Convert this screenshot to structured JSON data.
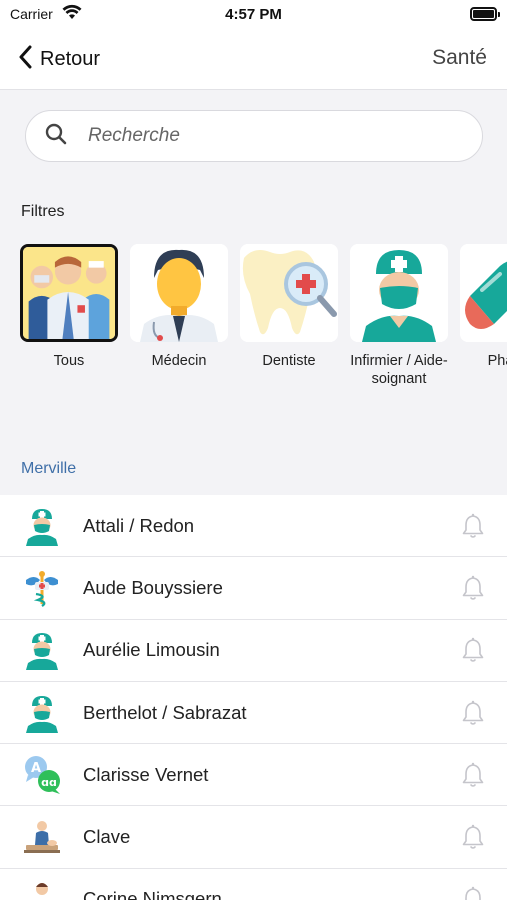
{
  "status_bar": {
    "carrier": "Carrier",
    "time": "4:57 PM"
  },
  "nav": {
    "back_label": "Retour",
    "title": "Santé"
  },
  "search": {
    "placeholder": "Recherche",
    "value": ""
  },
  "filters": {
    "label": "Filtres",
    "items": [
      {
        "label": "Tous",
        "icon": "medical-team-icon",
        "selected": true
      },
      {
        "label": "Médecin",
        "icon": "doctor-icon",
        "selected": false
      },
      {
        "label": "Dentiste",
        "icon": "tooth-icon",
        "selected": false
      },
      {
        "label": "Infirmier / Aide-soignant",
        "icon": "nurse-icon",
        "selected": false
      },
      {
        "label": "Pharm",
        "icon": "pill-icon",
        "selected": false
      }
    ]
  },
  "section": {
    "title": "Merville"
  },
  "list": [
    {
      "name": "Attali / Redon",
      "icon": "nurse-icon"
    },
    {
      "name": "Aude Bouyssiere",
      "icon": "caduceus-icon"
    },
    {
      "name": "Aurélie Limousin",
      "icon": "nurse-icon"
    },
    {
      "name": "Berthelot / Sabrazat",
      "icon": "nurse-icon"
    },
    {
      "name": "Clarisse Vernet",
      "icon": "speech-bubbles-icon"
    },
    {
      "name": "Clave",
      "icon": "physiotherapist-icon"
    },
    {
      "name": "Corine Nimsgern",
      "icon": "person-icon"
    }
  ],
  "colors": {
    "accent": "#3f6fa8",
    "teal": "#17a89a",
    "background": "#f3f3f6"
  }
}
